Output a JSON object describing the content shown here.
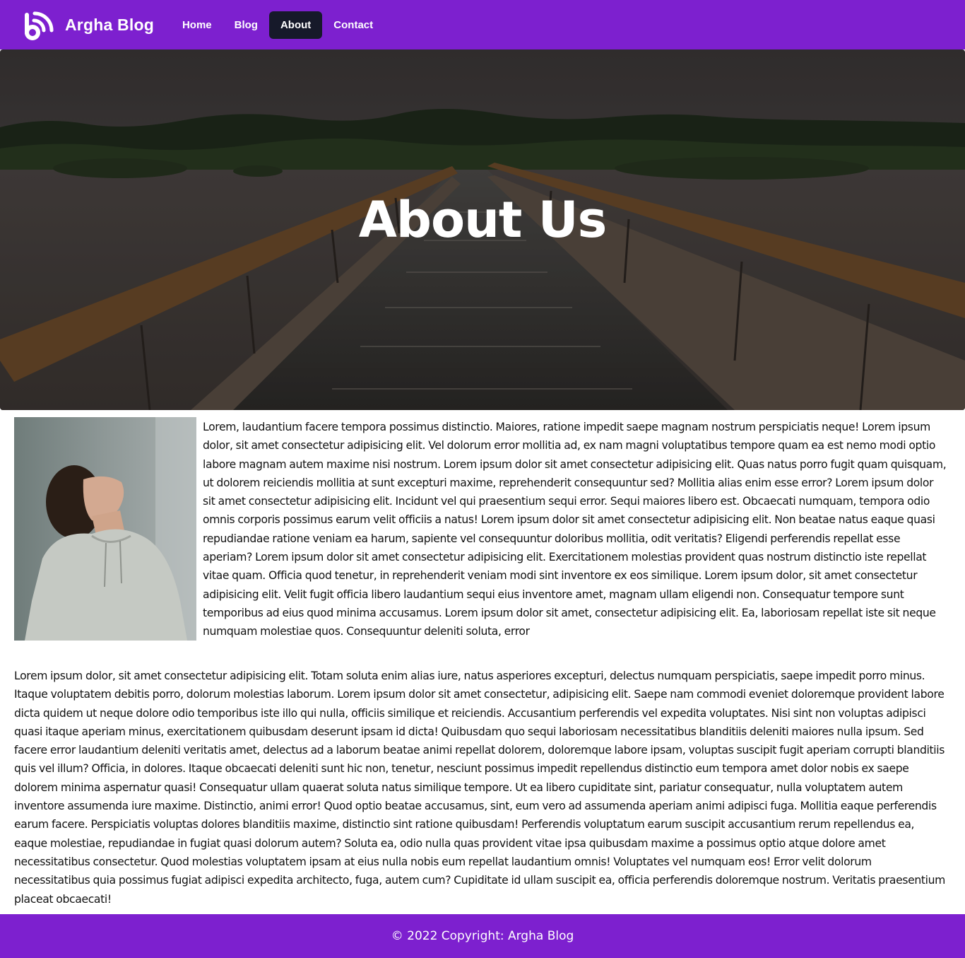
{
  "navbar": {
    "brand": "Argha Blog",
    "links": [
      {
        "label": "Home"
      },
      {
        "label": "Blog"
      },
      {
        "label": "About",
        "active": true
      },
      {
        "label": "Contact"
      }
    ],
    "background_color": "#7d20cf",
    "active_color": "#16192a"
  },
  "hero": {
    "title": "About Us",
    "image": "boardwalk-bridge-over-river-photo"
  },
  "content": {
    "portrait_image": "man-in-hoodie-looking-up-photo",
    "paragraph1": "Lorem, laudantium facere tempora possimus distinctio. Maiores, ratione impedit saepe magnam nostrum perspiciatis neque! Lorem ipsum dolor, sit amet consectetur adipisicing elit. Vel dolorum error mollitia ad, ex nam magni voluptatibus tempore quam ea est nemo modi optio labore magnam autem maxime nisi nostrum. Lorem ipsum dolor sit amet consectetur adipisicing elit. Quas natus porro fugit quam quisquam, ut dolorem reiciendis mollitia at sunt excepturi maxime, reprehenderit consequuntur sed? Mollitia alias enim esse error? Lorem ipsum dolor sit amet consectetur adipisicing elit. Incidunt vel qui praesentium sequi error. Sequi maiores libero est. Obcaecati numquam, tempora odio omnis corporis possimus earum velit officiis a natus! Lorem ipsum dolor sit amet consectetur adipisicing elit. Non beatae natus eaque quasi repudiandae ratione veniam ea harum, sapiente vel consequuntur doloribus mollitia, odit veritatis? Eligendi perferendis repellat esse aperiam? Lorem ipsum dolor sit amet consectetur adipisicing elit. Exercitationem molestias provident quas nostrum distinctio iste repellat vitae quam. Officia quod tenetur, in reprehenderit veniam modi sint inventore ex eos similique. Lorem ipsum dolor, sit amet consectetur adipisicing elit. Velit fugit officia libero laudantium sequi eius inventore amet, magnam ullam eligendi non. Consequatur tempore sunt temporibus ad eius quod minima accusamus. Lorem ipsum dolor sit amet, consectetur adipisicing elit. Ea, laboriosam repellat iste sit neque numquam molestiae quos. Consequuntur deleniti soluta, error",
    "paragraph2": "Lorem ipsum dolor, sit amet consectetur adipisicing elit. Totam soluta enim alias iure, natus asperiores excepturi, delectus numquam perspiciatis, saepe impedit porro minus. Itaque voluptatem debitis porro, dolorum molestias laborum. Lorem ipsum dolor sit amet consectetur, adipisicing elit. Saepe nam commodi eveniet doloremque provident labore dicta quidem ut neque dolore odio temporibus iste illo qui nulla, officiis similique et reiciendis. Accusantium perferendis vel expedita voluptates. Nisi sint non voluptas adipisci quasi itaque aperiam minus, exercitationem quibusdam deserunt ipsam id dicta! Quibusdam quo sequi laboriosam necessitatibus blanditiis deleniti maiores nulla ipsum. Sed facere error laudantium deleniti veritatis amet, delectus ad a laborum beatae animi repellat dolorem, doloremque labore ipsam, voluptas suscipit fugit aperiam corrupti blanditiis quis vel illum? Officia, in dolores. Itaque obcaecati deleniti sunt hic non, tenetur, nesciunt possimus impedit repellendus distinctio eum tempora amet dolor nobis ex saepe dolorem minima aspernatur quasi! Consequatur ullam quaerat soluta natus similique tempore. Ut ea libero cupiditate sint, pariatur consequatur, nulla voluptatem autem inventore assumenda iure maxime. Distinctio, animi error! Quod optio beatae accusamus, sint, eum vero ad assumenda aperiam animi adipisci fuga. Mollitia eaque perferendis earum facere. Perspiciatis voluptas dolores blanditiis maxime, distinctio sint ratione quibusdam! Perferendis voluptatum earum suscipit accusantium rerum repellendus ea, eaque molestiae, repudiandae in fugiat quasi dolorum autem? Soluta ea, odio nulla quas provident vitae ipsa quibusdam maxime a possimus optio atque dolore amet necessitatibus consectetur. Quod molestias voluptatem ipsam at eius nulla nobis eum repellat laudantium omnis! Voluptates vel numquam eos! Error velit dolorum necessitatibus quia possimus fugiat adipisci expedita architecto, fuga, autem cum? Cupiditate id ullam suscipit ea, officia perferendis doloremque nostrum. Veritatis praesentium placeat obcaecati!"
  },
  "footer": {
    "text": "© 2022 Copyright: Argha Blog"
  }
}
